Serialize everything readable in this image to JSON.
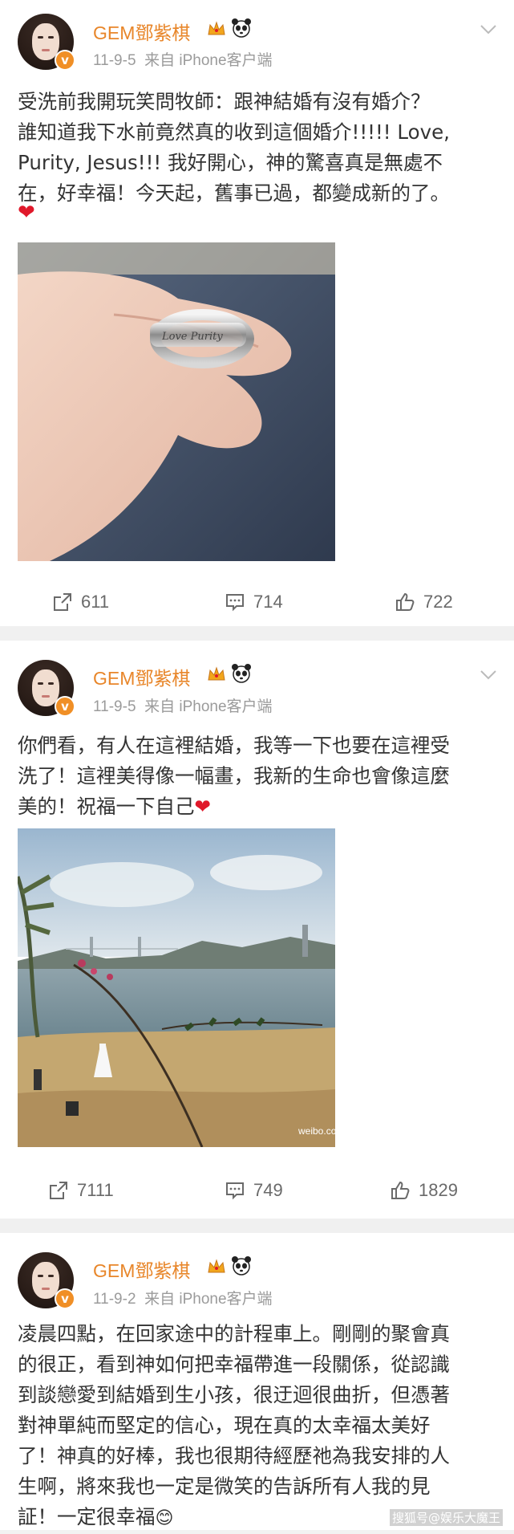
{
  "posts": [
    {
      "author": "GEM鄧紫棋",
      "time": "11-9-5",
      "source": "来自 iPhone客户端",
      "text": "受洗前我開玩笑問牧師：跟神結婚有沒有婚介？\n誰知道我下水前竟然真的收到這個婚介!!!!! Love,\nPurity, Jesus!!! 我好開心，神的驚喜真是無處不\n在，好幸福！今天起，舊事已過，都變成新的了。",
      "emoji": "❤",
      "image": "ring-photo",
      "reposts": "611",
      "comments": "714",
      "likes": "722"
    },
    {
      "author": "GEM鄧紫棋",
      "time": "11-9-5",
      "source": "来自 iPhone客户端",
      "text": "你們看，有人在這裡結婚，我等一下也要在這裡受\n洗了！這裡美得像一幅畫，我新的生命也會像這麼\n美的！祝福一下自己",
      "emoji": "❤",
      "image": "beach-photo",
      "image_watermark": "weibo.com/",
      "reposts": "7111",
      "comments": "749",
      "likes": "1829"
    },
    {
      "author": "GEM鄧紫棋",
      "time": "11-9-2",
      "source": "来自 iPhone客户端",
      "text": "凌晨四點，在回家途中的計程車上。剛剛的聚會真\n的很正，看到神如何把幸福帶進一段關係，從認識\n到談戀愛到結婚到生小孩，很迂迴很曲折，但憑著\n對神單純而堅定的信心，現在真的太幸福太美好\n了！神真的好棒，我也很期待經歷祂為我安排的人\n生啊，將來我也一定是微笑的告訴所有人我的見\n証！一定很幸福",
      "emoji": "😊"
    }
  ],
  "page_watermark": "搜狐号@娱乐大魔王",
  "colors": {
    "name": "#e8862a",
    "heart": "#e0182a",
    "vip_badge": "#f08f26"
  }
}
